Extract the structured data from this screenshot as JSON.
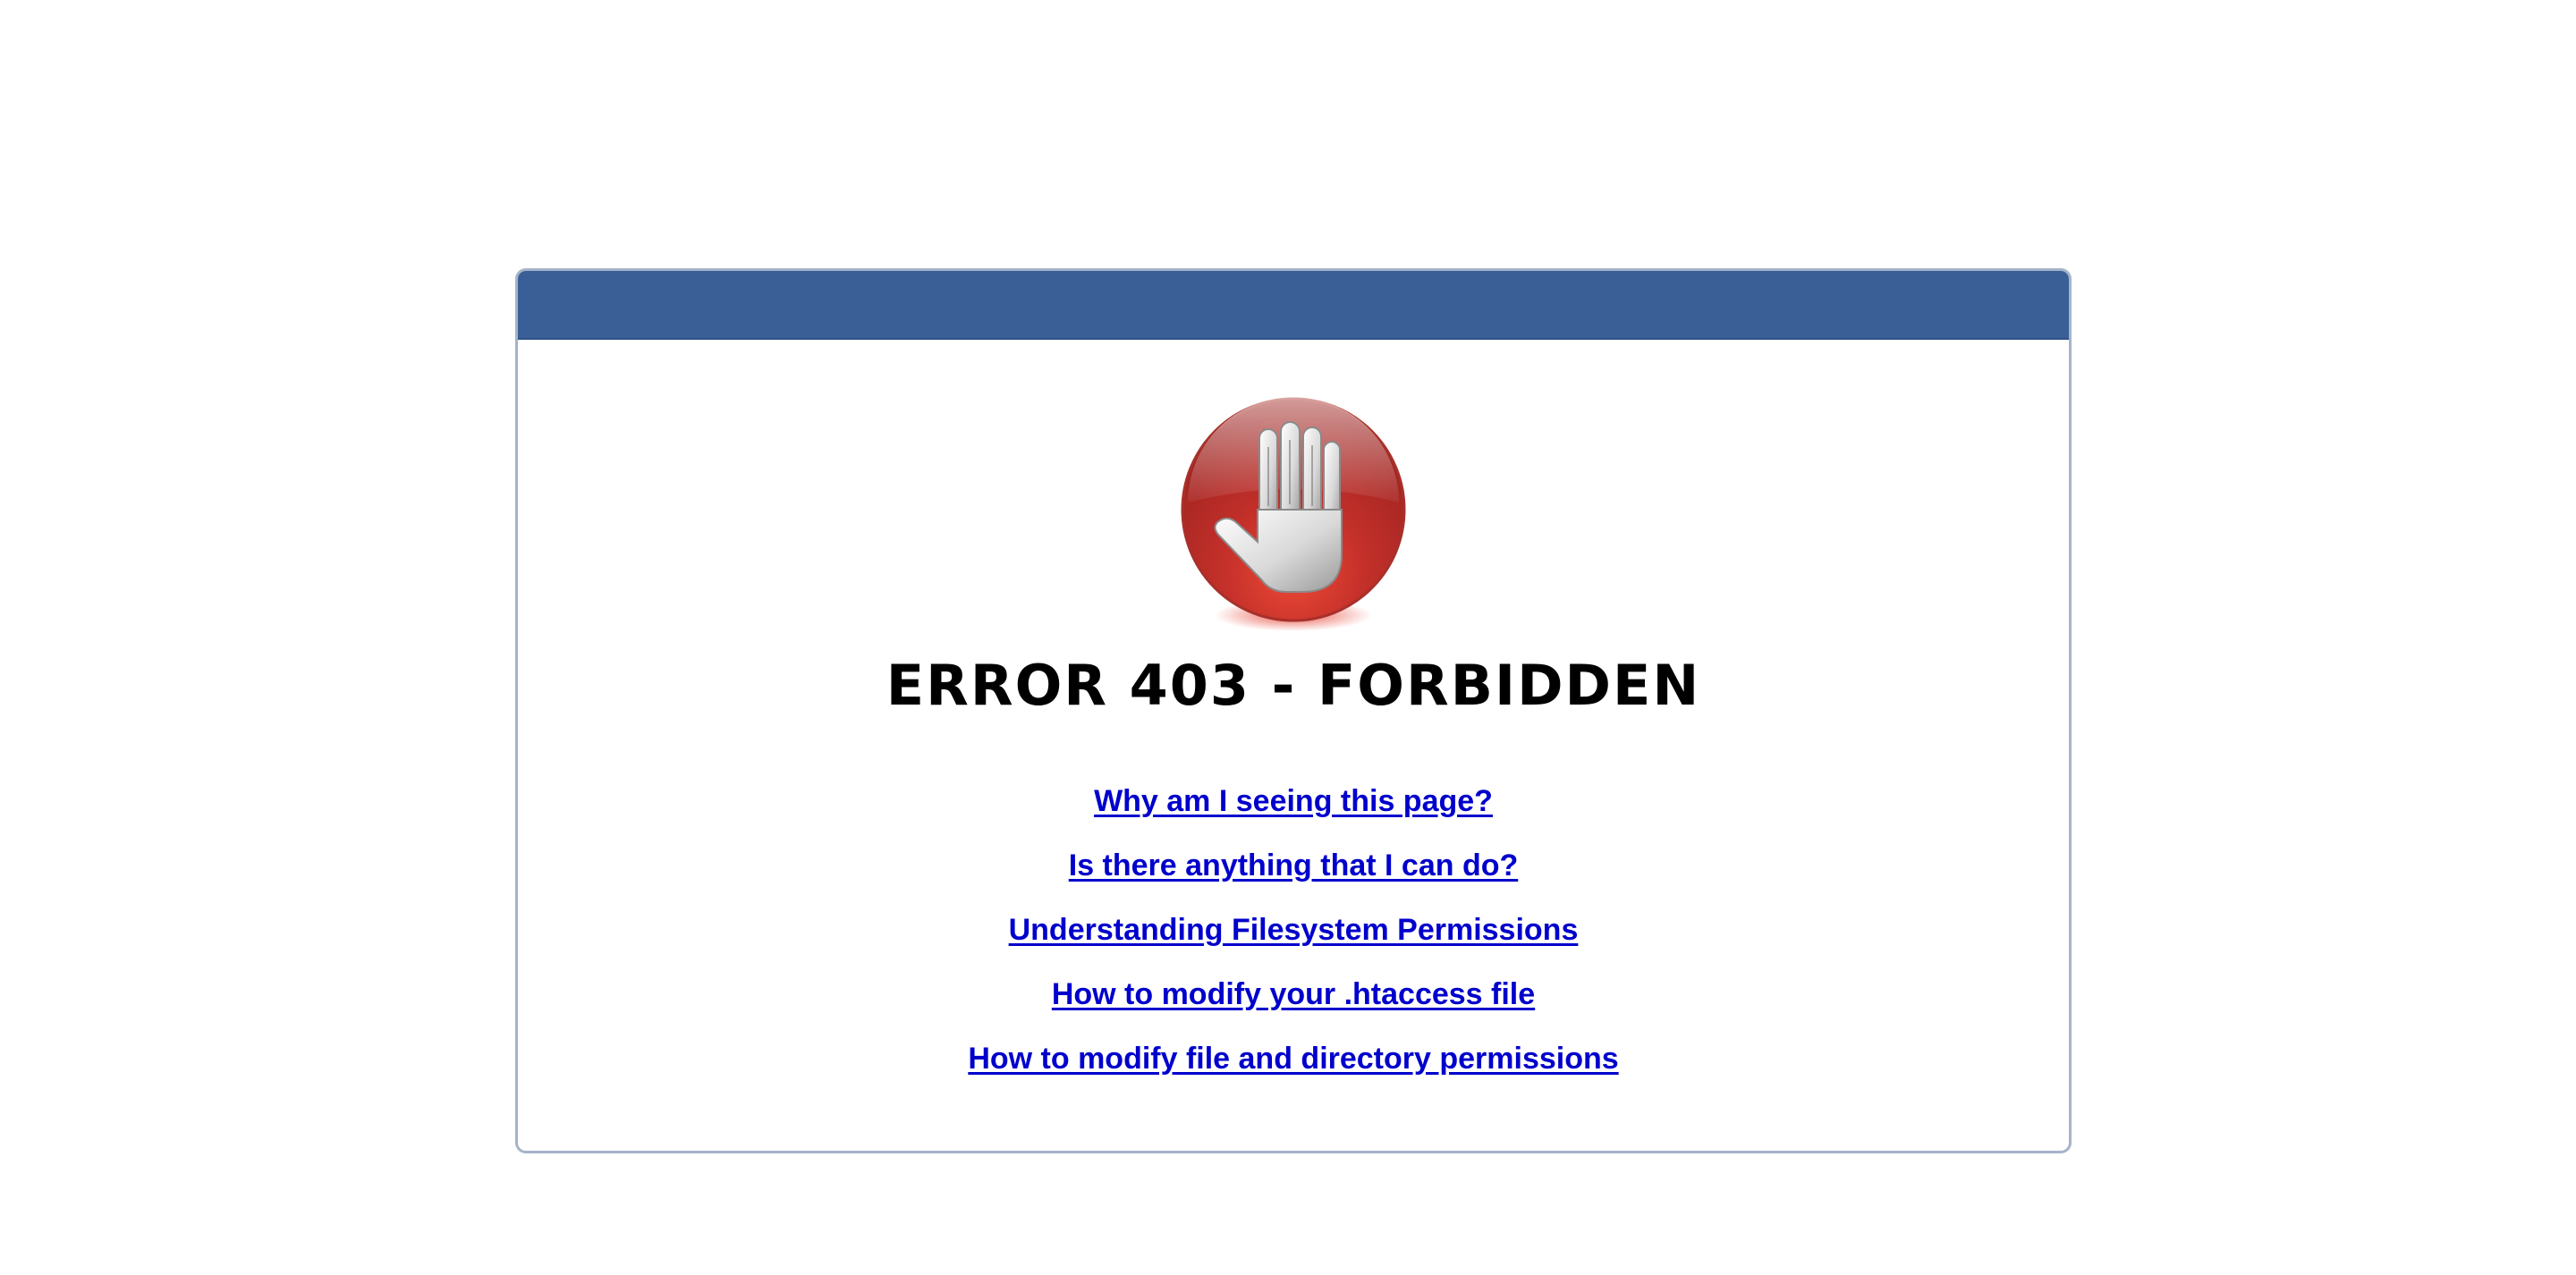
{
  "error": {
    "title": "ERROR 403 - FORBIDDEN"
  },
  "colors": {
    "header_bar": "#3a5f96",
    "panel_border": "#a5b4c8",
    "link": "#0000cc",
    "icon_red": "#c0302a"
  },
  "icons": {
    "stop": "stop-hand-icon"
  },
  "links": [
    {
      "label": "Why am I seeing this page?"
    },
    {
      "label": "Is there anything that I can do?"
    },
    {
      "label": "Understanding Filesystem Permissions"
    },
    {
      "label": "How to modify your .htaccess file"
    },
    {
      "label": "How to modify file and directory permissions"
    }
  ]
}
